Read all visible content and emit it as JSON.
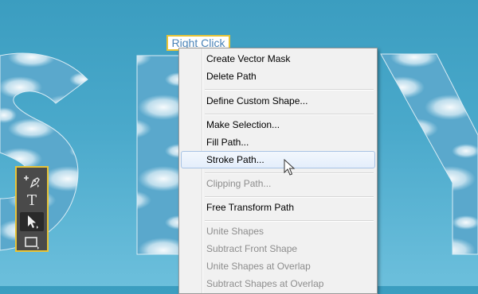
{
  "callout": {
    "label": "Right Click"
  },
  "context_menu": {
    "items": [
      {
        "label": "Create Vector Mask",
        "enabled": true
      },
      {
        "label": "Delete Path",
        "enabled": true
      },
      {
        "label": "Define Custom Shape...",
        "enabled": true
      },
      {
        "label": "Make Selection...",
        "enabled": true
      },
      {
        "label": "Fill Path...",
        "enabled": true
      },
      {
        "label": "Stroke Path...",
        "enabled": true,
        "highlighted": true
      },
      {
        "label": "Clipping Path...",
        "enabled": false
      },
      {
        "label": "Free Transform Path",
        "enabled": true
      },
      {
        "label": "Unite Shapes",
        "enabled": false
      },
      {
        "label": "Subtract Front Shape",
        "enabled": false
      },
      {
        "label": "Unite Shapes at Overlap",
        "enabled": false
      },
      {
        "label": "Subtract Shapes at Overlap",
        "enabled": false
      }
    ]
  },
  "toolbox": {
    "tools": [
      {
        "icon": "pen-add-anchor-icon"
      },
      {
        "icon": "type-tool-icon",
        "glyph": "T"
      },
      {
        "icon": "path-selection-arrow-icon",
        "active": true
      },
      {
        "icon": "rectangle-shape-icon"
      }
    ]
  },
  "colors": {
    "sky_top": "#3b9dc0",
    "sky_bottom": "#6cbfdc",
    "highlight_border": "#e8c437",
    "callout_text": "#4b84b8",
    "menu_background": "#f1f1f1",
    "disabled_text": "#8d8d8d"
  }
}
